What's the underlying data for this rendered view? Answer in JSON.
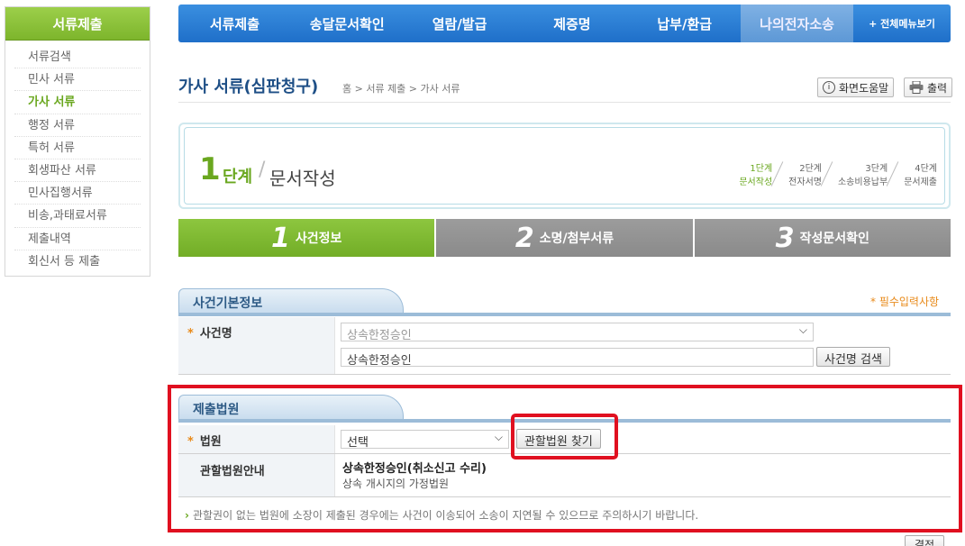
{
  "sidebar": {
    "title": "서류제출",
    "items": [
      "서류검색",
      "민사 서류",
      "가사 서류",
      "행정 서류",
      "특허 서류",
      "회생파산 서류",
      "민사집행서류",
      "비송,과태료서류",
      "제출내역",
      "회신서 등 제출"
    ],
    "active_index": 2
  },
  "topnav": {
    "items": [
      "서류제출",
      "송달문서확인",
      "열람/발급",
      "제증명",
      "납부/환급",
      "나의전자소송"
    ],
    "active_index": 5,
    "all_menu": "+ 전체메뉴보기"
  },
  "page": {
    "title": "가사 서류(심판청구)",
    "breadcrumb": "홈 > 서류 제출 > 가사 서류",
    "help_label": "화면도움말",
    "print_label": "출력"
  },
  "step": {
    "number": "1",
    "word": "단계",
    "desc": "문서작성",
    "mini": [
      {
        "top": "1단계",
        "bottom": "문서작성"
      },
      {
        "top": "2단계",
        "bottom": "전자서명"
      },
      {
        "top": "3단계",
        "bottom": "소송비용납부"
      },
      {
        "top": "4단계",
        "bottom": "문서제출"
      }
    ]
  },
  "tabs": [
    {
      "num": "1",
      "label": "사건정보"
    },
    {
      "num": "2",
      "label": "소명/첨부서류"
    },
    {
      "num": "3",
      "label": "작성문서확인"
    }
  ],
  "case_section": {
    "title": "사건기본정보",
    "required_note": "* 필수입력사항",
    "case_label": "사건명",
    "case_select": "상속한정승인",
    "case_input": "상속한정승인",
    "search_button": "사건명 검색"
  },
  "court_section": {
    "title": "제출법원",
    "court_label": "법원",
    "court_select": "선택",
    "find_button": "관할법원 찾기",
    "guide_label": "관할법원안내",
    "guide_bold": "상속한정승인(취소신고 수리)",
    "guide_sub": "상속 개시지의 가정법원",
    "notice": "관할권이 없는 법원에 소장이 제출된 경우에는 사건이 이송되어 소송이 지연될 수 있으므로 주의하시기 바랍니다."
  },
  "footer": {
    "confirm_button": "결정"
  },
  "colors": {
    "brand_green": "#7db52c",
    "nav_blue": "#1f6fc9",
    "highlight_red": "#e01020",
    "required_orange": "#e88a1a"
  }
}
